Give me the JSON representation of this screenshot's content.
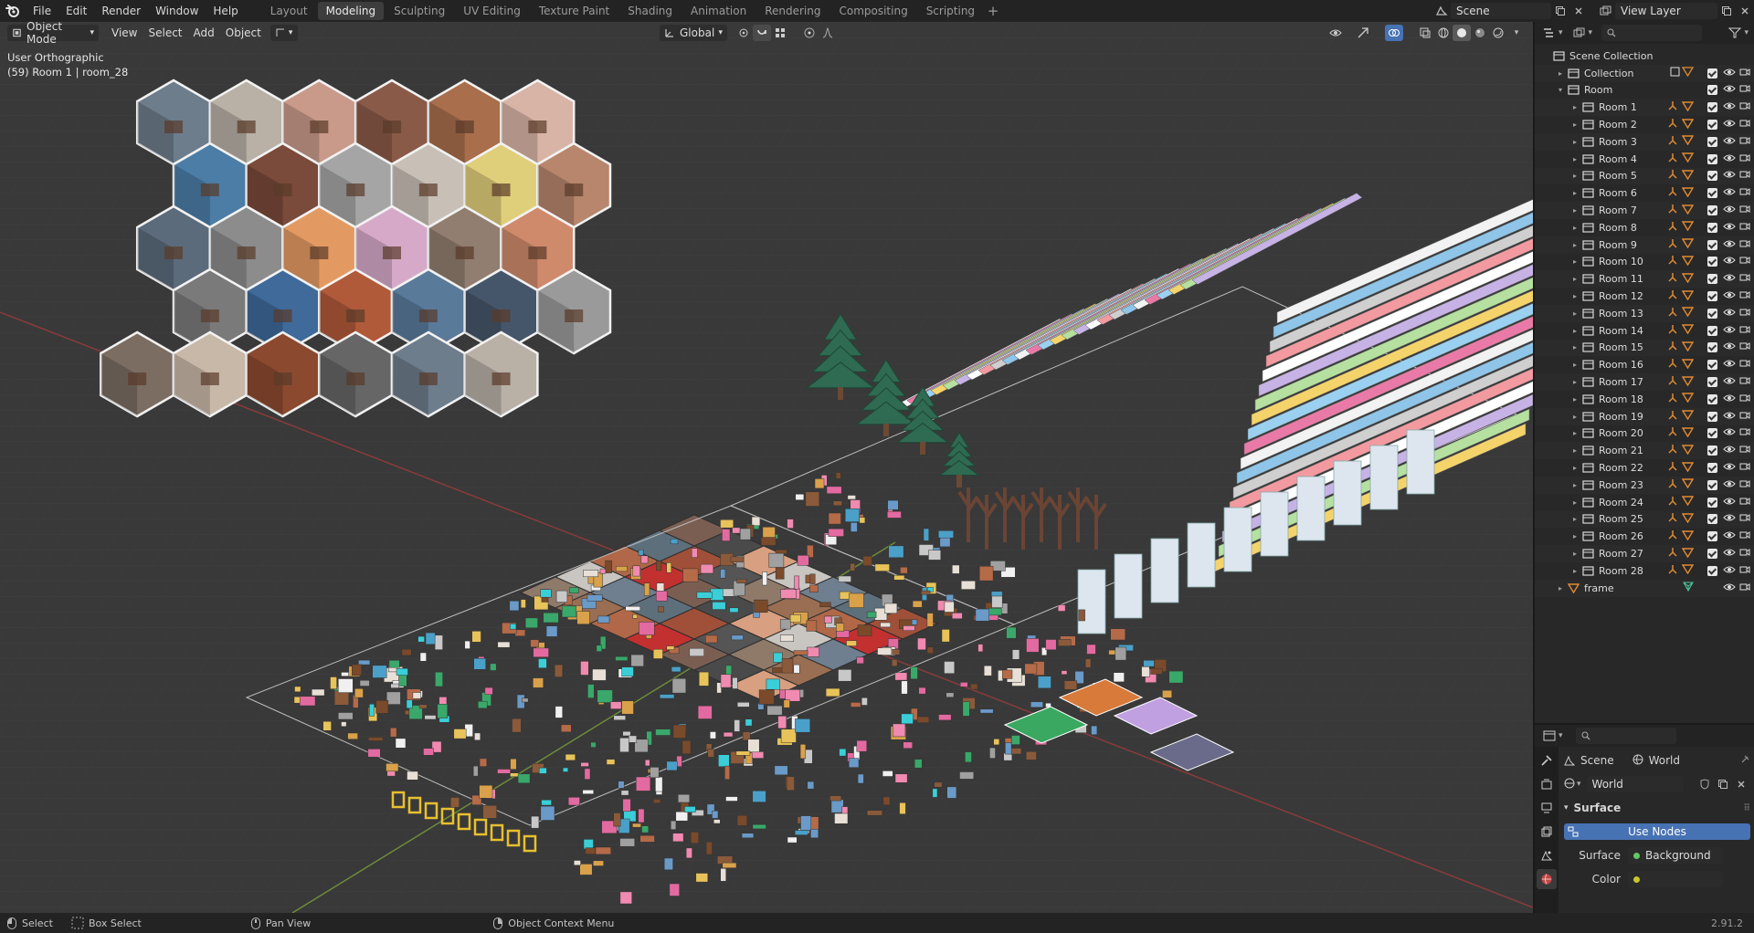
{
  "topbar": {
    "menus": [
      "File",
      "Edit",
      "Render",
      "Window",
      "Help"
    ],
    "workspaces": [
      {
        "label": "Layout",
        "active": false
      },
      {
        "label": "Modeling",
        "active": true
      },
      {
        "label": "Sculpting",
        "active": false
      },
      {
        "label": "UV Editing",
        "active": false
      },
      {
        "label": "Texture Paint",
        "active": false
      },
      {
        "label": "Shading",
        "active": false
      },
      {
        "label": "Animation",
        "active": false
      },
      {
        "label": "Rendering",
        "active": false
      },
      {
        "label": "Compositing",
        "active": false
      },
      {
        "label": "Scripting",
        "active": false
      }
    ],
    "add_workspace": "+",
    "scene_name": "Scene",
    "view_layer_name": "View Layer"
  },
  "viewport": {
    "mode": "Object Mode",
    "menus": [
      "View",
      "Select",
      "Add",
      "Object"
    ],
    "orientation": "Global",
    "view_label": "User Orthographic",
    "object_info": "(59) Room 1 | room_28"
  },
  "outliner": {
    "search_placeholder": "",
    "rows": [
      {
        "name": "Scene Collection",
        "level": 0,
        "type": "collection",
        "twisty": "",
        "extras": "",
        "check": false,
        "eye": false,
        "cam": false
      },
      {
        "name": "Collection",
        "level": 1,
        "type": "collection",
        "twisty": "▸",
        "extras": "32 99",
        "check": true,
        "eye": true,
        "cam": true
      },
      {
        "name": "Room",
        "level": 1,
        "type": "collection",
        "twisty": "▾",
        "extras": "",
        "check": true,
        "eye": true,
        "cam": true
      },
      {
        "name": "Room 1",
        "level": 2,
        "type": "collection",
        "twisty": "▸",
        "extras": "obj",
        "check": true,
        "eye": true,
        "cam": true
      },
      {
        "name": "Room 2",
        "level": 2,
        "type": "collection",
        "twisty": "▸",
        "extras": "obj",
        "check": true,
        "eye": true,
        "cam": true
      },
      {
        "name": "Room 3",
        "level": 2,
        "type": "collection",
        "twisty": "▸",
        "extras": "obj",
        "check": true,
        "eye": true,
        "cam": true
      },
      {
        "name": "Room 4",
        "level": 2,
        "type": "collection",
        "twisty": "▸",
        "extras": "obj",
        "check": true,
        "eye": true,
        "cam": true
      },
      {
        "name": "Room 5",
        "level": 2,
        "type": "collection",
        "twisty": "▸",
        "extras": "obj",
        "check": true,
        "eye": true,
        "cam": true
      },
      {
        "name": "Room 6",
        "level": 2,
        "type": "collection",
        "twisty": "▸",
        "extras": "obj",
        "check": true,
        "eye": true,
        "cam": true
      },
      {
        "name": "Room 7",
        "level": 2,
        "type": "collection",
        "twisty": "▸",
        "extras": "obj",
        "check": true,
        "eye": true,
        "cam": true
      },
      {
        "name": "Room 8",
        "level": 2,
        "type": "collection",
        "twisty": "▸",
        "extras": "obj",
        "check": true,
        "eye": true,
        "cam": true
      },
      {
        "name": "Room 9",
        "level": 2,
        "type": "collection",
        "twisty": "▸",
        "extras": "obj",
        "check": true,
        "eye": true,
        "cam": true
      },
      {
        "name": "Room 10",
        "level": 2,
        "type": "collection",
        "twisty": "▸",
        "extras": "obj",
        "check": true,
        "eye": true,
        "cam": true
      },
      {
        "name": "Room 11",
        "level": 2,
        "type": "collection",
        "twisty": "▸",
        "extras": "obj",
        "check": true,
        "eye": true,
        "cam": true
      },
      {
        "name": "Room 12",
        "level": 2,
        "type": "collection",
        "twisty": "▸",
        "extras": "obj",
        "check": true,
        "eye": true,
        "cam": true
      },
      {
        "name": "Room 13",
        "level": 2,
        "type": "collection",
        "twisty": "▸",
        "extras": "obj",
        "check": true,
        "eye": true,
        "cam": true
      },
      {
        "name": "Room 14",
        "level": 2,
        "type": "collection",
        "twisty": "▸",
        "extras": "obj",
        "check": true,
        "eye": true,
        "cam": true
      },
      {
        "name": "Room 15",
        "level": 2,
        "type": "collection",
        "twisty": "▸",
        "extras": "obj",
        "check": true,
        "eye": true,
        "cam": true
      },
      {
        "name": "Room 16",
        "level": 2,
        "type": "collection",
        "twisty": "▸",
        "extras": "obj",
        "check": true,
        "eye": true,
        "cam": true
      },
      {
        "name": "Room 17",
        "level": 2,
        "type": "collection",
        "twisty": "▸",
        "extras": "obj",
        "check": true,
        "eye": true,
        "cam": true
      },
      {
        "name": "Room 18",
        "level": 2,
        "type": "collection",
        "twisty": "▸",
        "extras": "obj",
        "check": true,
        "eye": true,
        "cam": true
      },
      {
        "name": "Room 19",
        "level": 2,
        "type": "collection",
        "twisty": "▸",
        "extras": "obj",
        "check": true,
        "eye": true,
        "cam": true
      },
      {
        "name": "Room 20",
        "level": 2,
        "type": "collection",
        "twisty": "▸",
        "extras": "obj",
        "check": true,
        "eye": true,
        "cam": true
      },
      {
        "name": "Room 21",
        "level": 2,
        "type": "collection",
        "twisty": "▸",
        "extras": "obj",
        "check": true,
        "eye": true,
        "cam": true
      },
      {
        "name": "Room 22",
        "level": 2,
        "type": "collection",
        "twisty": "▸",
        "extras": "obj",
        "check": true,
        "eye": true,
        "cam": true
      },
      {
        "name": "Room 23",
        "level": 2,
        "type": "collection",
        "twisty": "▸",
        "extras": "obj",
        "check": true,
        "eye": true,
        "cam": true
      },
      {
        "name": "Room 24",
        "level": 2,
        "type": "collection",
        "twisty": "▸",
        "extras": "obj",
        "check": true,
        "eye": true,
        "cam": true
      },
      {
        "name": "Room 25",
        "level": 2,
        "type": "collection",
        "twisty": "▸",
        "extras": "obj",
        "check": true,
        "eye": true,
        "cam": true
      },
      {
        "name": "Room 26",
        "level": 2,
        "type": "collection",
        "twisty": "▸",
        "extras": "obj",
        "check": true,
        "eye": true,
        "cam": true
      },
      {
        "name": "Room 27",
        "level": 2,
        "type": "collection",
        "twisty": "▸",
        "extras": "obj",
        "check": true,
        "eye": true,
        "cam": true
      },
      {
        "name": "Room 28",
        "level": 2,
        "type": "collection",
        "twisty": "▸",
        "extras": "obj",
        "check": true,
        "eye": true,
        "cam": true
      },
      {
        "name": "frame",
        "level": 1,
        "type": "object",
        "twisty": "▸",
        "extras": "mesh",
        "check": false,
        "eye": true,
        "cam": true
      }
    ]
  },
  "properties": {
    "context_scene": "Scene",
    "context_world": "World",
    "world_name": "World",
    "panel_title": "Surface",
    "use_nodes_label": "Use Nodes",
    "surface_label": "Surface",
    "surface_value": "Background",
    "color_label": "Color"
  },
  "statusbar": {
    "select": "Select",
    "box_select": "Box Select",
    "pan_view": "Pan View",
    "context_menu": "Object Context Menu",
    "version": "2.91.2"
  },
  "colors": {
    "accent": "#4772b3",
    "active_tab": "#3d3d3d",
    "viewport_bg": "#393939",
    "panel_bg": "#282828",
    "collection_icon": "#d8d8d8",
    "object_icon": "#e08a32",
    "mesh_icon": "#4ac29a"
  }
}
